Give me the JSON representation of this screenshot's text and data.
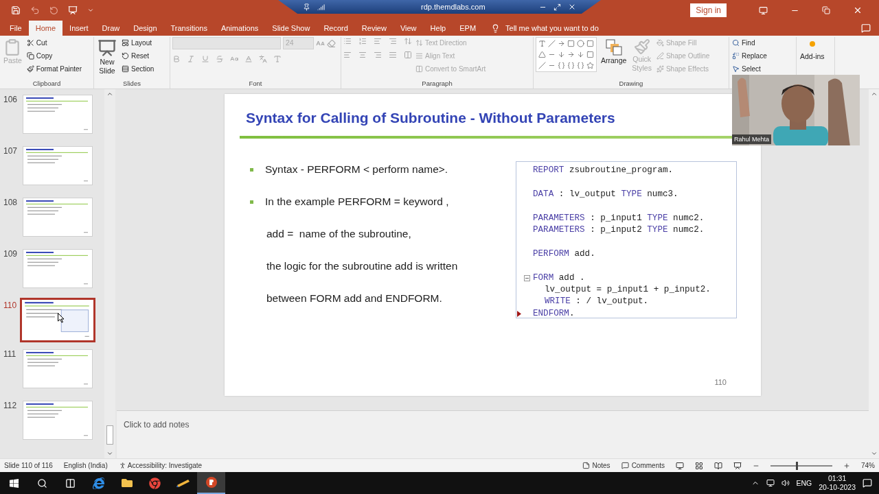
{
  "title_bar": {
    "remote_host": "rdp.themdlabs.com",
    "sign_in": "Sign in"
  },
  "tabs": [
    {
      "label": "File",
      "selected": false
    },
    {
      "label": "Home",
      "selected": true
    },
    {
      "label": "Insert",
      "selected": false
    },
    {
      "label": "Draw",
      "selected": false
    },
    {
      "label": "Design",
      "selected": false
    },
    {
      "label": "Transitions",
      "selected": false
    },
    {
      "label": "Animations",
      "selected": false
    },
    {
      "label": "Slide Show",
      "selected": false
    },
    {
      "label": "Record",
      "selected": false
    },
    {
      "label": "Review",
      "selected": false
    },
    {
      "label": "View",
      "selected": false
    },
    {
      "label": "Help",
      "selected": false
    },
    {
      "label": "EPM",
      "selected": false
    }
  ],
  "tell_me": {
    "placeholder": "Tell me what you want to do"
  },
  "ribbon": {
    "clipboard": {
      "label": "Clipboard",
      "paste": {
        "label": "Paste",
        "disabled": true
      },
      "commands": [
        {
          "label": "Cut",
          "disabled": false
        },
        {
          "label": "Copy",
          "disabled": false
        },
        {
          "label": "Format Painter",
          "disabled": false
        }
      ]
    },
    "slides": {
      "label": "Slides",
      "new_slide": [
        "New",
        "Slide"
      ],
      "commands": [
        {
          "label": "Layout",
          "disabled": false
        },
        {
          "label": "Reset",
          "disabled": false
        },
        {
          "label": "Section",
          "disabled": false
        }
      ]
    },
    "font": {
      "label": "Font",
      "size": "24"
    },
    "paragraph": {
      "label": "Paragraph",
      "commands": [
        {
          "label": "Text Direction",
          "disabled": true
        },
        {
          "label": "Align Text",
          "disabled": true
        },
        {
          "label": "Convert to SmartArt",
          "disabled": true
        }
      ]
    },
    "drawing": {
      "label": "Drawing",
      "arrange": "Arrange",
      "quick_styles": {
        "lines": [
          "Quick",
          "Styles"
        ],
        "disabled": true
      },
      "commands": [
        {
          "label": "Shape Fill",
          "disabled": true
        },
        {
          "label": "Shape Outline",
          "disabled": true
        },
        {
          "label": "Shape Effects",
          "disabled": true
        }
      ]
    },
    "editing": {
      "commands": [
        {
          "label": "Find",
          "disabled": false
        },
        {
          "label": "Replace",
          "disabled": false
        },
        {
          "label": "Select",
          "disabled": false
        }
      ]
    },
    "add_ins": {
      "label": "Add-ins"
    }
  },
  "thumbnails": [
    {
      "number": "106",
      "selected": false
    },
    {
      "number": "107",
      "selected": false
    },
    {
      "number": "108",
      "selected": false
    },
    {
      "number": "109",
      "selected": false
    },
    {
      "number": "110",
      "selected": true
    },
    {
      "number": "111",
      "selected": false
    },
    {
      "number": "112",
      "selected": false
    }
  ],
  "slide": {
    "title": "Syntax for Calling of Subroutine - Without Parameters",
    "items": [
      {
        "text": "Syntax - PERFORM < perform name>.",
        "bullet": true
      },
      {
        "text": "In the example PERFORM = keyword ,",
        "bullet": true
      },
      {
        "text": "add =  name of the subroutine,",
        "bullet": false
      },
      {
        "text": "the logic for the subroutine add is written",
        "bullet": false
      },
      {
        "text": "between FORM add and ENDFORM.",
        "bullet": false
      }
    ],
    "code": {
      "lines": [
        {
          "gap_before": false,
          "indent": false,
          "fold": false,
          "marker": false,
          "tokens": [
            {
              "text": "REPORT",
              "kind": "keyword"
            },
            {
              "text": " zsubroutine_program.",
              "kind": "plain"
            }
          ]
        },
        {
          "gap_before": true,
          "indent": false,
          "fold": false,
          "marker": false,
          "tokens": [
            {
              "text": "DATA",
              "kind": "keyword"
            },
            {
              "text": " : lv_output ",
              "kind": "plain"
            },
            {
              "text": "TYPE",
              "kind": "keyword"
            },
            {
              "text": " numc3.",
              "kind": "plain"
            }
          ]
        },
        {
          "gap_before": true,
          "indent": false,
          "fold": false,
          "marker": false,
          "tokens": [
            {
              "text": "PARAMETERS",
              "kind": "keyword"
            },
            {
              "text": " : p_input1 ",
              "kind": "plain"
            },
            {
              "text": "TYPE",
              "kind": "keyword"
            },
            {
              "text": " numc2.",
              "kind": "plain"
            }
          ]
        },
        {
          "gap_before": false,
          "indent": false,
          "fold": false,
          "marker": false,
          "tokens": [
            {
              "text": "PARAMETERS",
              "kind": "keyword"
            },
            {
              "text": " : p_input2 ",
              "kind": "plain"
            },
            {
              "text": "TYPE",
              "kind": "keyword"
            },
            {
              "text": " numc2.",
              "kind": "plain"
            }
          ]
        },
        {
          "gap_before": true,
          "indent": false,
          "fold": false,
          "marker": false,
          "tokens": [
            {
              "text": "PERFORM",
              "kind": "keyword"
            },
            {
              "text": " add.",
              "kind": "plain"
            }
          ]
        },
        {
          "gap_before": true,
          "indent": false,
          "fold": true,
          "marker": false,
          "tokens": [
            {
              "text": "FORM",
              "kind": "keyword"
            },
            {
              "text": " add .",
              "kind": "plain"
            }
          ]
        },
        {
          "gap_before": false,
          "indent": true,
          "fold": false,
          "marker": false,
          "tokens": [
            {
              "text": "lv_output = p_input1 + p_input2.",
              "kind": "plain"
            }
          ]
        },
        {
          "gap_before": false,
          "indent": true,
          "fold": false,
          "marker": false,
          "tokens": [
            {
              "text": "WRITE",
              "kind": "keyword"
            },
            {
              "text": " : / lv_output.",
              "kind": "plain"
            }
          ]
        },
        {
          "gap_before": false,
          "indent": false,
          "fold": false,
          "marker": true,
          "tokens": [
            {
              "text": "ENDFORM",
              "kind": "keyword"
            },
            {
              "text": ".",
              "kind": "plain"
            }
          ]
        }
      ]
    },
    "number": "110"
  },
  "notes": {
    "placeholder": "Click to add notes"
  },
  "webcam": {
    "kind": "picture",
    "name": "Rahul Mehta"
  },
  "status_bar": {
    "slide": "Slide 110 of 116",
    "language": "English (India)",
    "accessibility": "Accessibility: Investigate",
    "notes": "Notes",
    "comments": "Comments",
    "zoom": {
      "level": 0.42,
      "reading": "74%"
    }
  },
  "taskbar": {
    "language": "ENG",
    "time": "01:31",
    "date": "20-10-2023"
  }
}
